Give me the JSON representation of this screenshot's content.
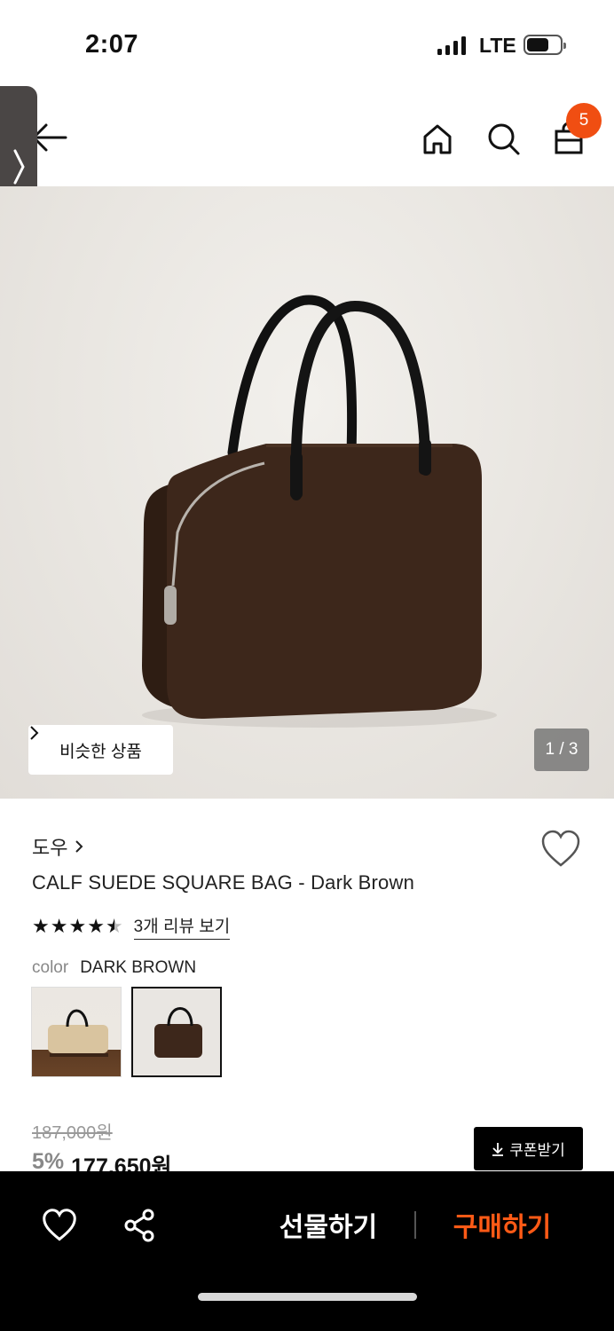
{
  "status_bar": {
    "time": "2:07",
    "network": "LTE"
  },
  "header": {
    "cart_count": "5"
  },
  "gallery": {
    "similar_label": "비슷한 상품",
    "page_indicator": "1 / 3"
  },
  "product": {
    "brand": "도우",
    "title": "CALF SUEDE SQUARE BAG - Dark Brown",
    "rating": 4.5,
    "review_link": "3개 리뷰 보기",
    "option_label": "color",
    "option_value": "DARK BROWN",
    "original_price": "187,000원",
    "discount": "5%",
    "final_price": "177,650원",
    "coupon_label": "쿠폰받기"
  },
  "bottom_bar": {
    "gift_label": "선물하기",
    "buy_label": "구매하기"
  },
  "colors": {
    "accent": "#f04e12",
    "buy": "#ff5a16",
    "bag": "#3d271b"
  },
  "icons": [
    "back-arrow-icon",
    "home-icon",
    "search-icon",
    "shopping-bag-icon",
    "heart-icon",
    "share-icon",
    "download-icon",
    "chevron-right-icon"
  ]
}
